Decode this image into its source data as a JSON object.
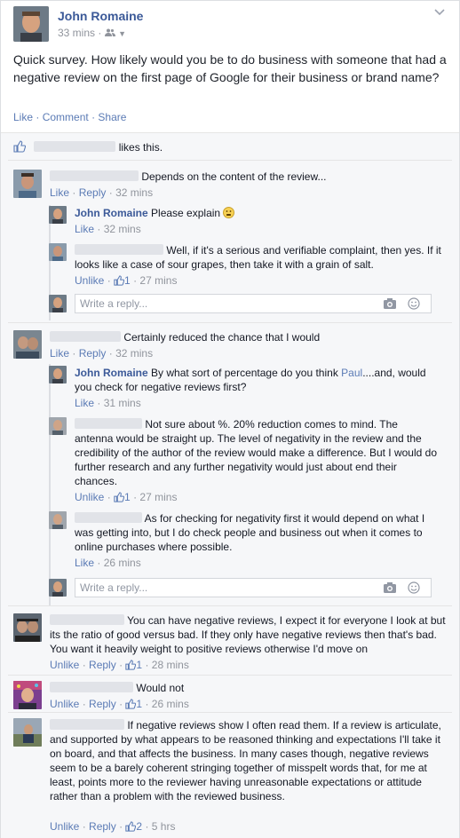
{
  "post": {
    "author": "John Romaine",
    "time": "33 mins",
    "text": "Quick survey. How likely would you be to do business with someone that had a negative review on the first page of Google for their business or brand name?",
    "actions": {
      "like": "Like",
      "comment": "Comment",
      "share": "Share",
      "sep": "·"
    }
  },
  "likes": {
    "suffix": "likes this."
  },
  "labels": {
    "like": "Like",
    "reply": "Reply",
    "unlike": "Unlike",
    "sep": "·"
  },
  "reply_placeholder": "Write a reply...",
  "comments": [
    {
      "text": "Depends on the content of the review...",
      "time": "32 mins"
    },
    {
      "author": "John Romaine",
      "text": "Please explain",
      "time": "32 mins"
    },
    {
      "text": "Well, if it's a serious and verifiable complaint, then yes. If it looks like a case of sour grapes, then take it with a grain of salt.",
      "likes": "1",
      "time": "27 mins"
    },
    {
      "text": "Certainly reduced the chance that I would",
      "time": "32 mins"
    },
    {
      "author": "John Romaine",
      "text_before": "By what sort of percentage do you think ",
      "mention": "Paul",
      "text_after": "....and, would you check for negative reviews first?",
      "time": "31 mins"
    },
    {
      "text": "Not sure about %. 20% reduction comes to mind. The antenna would be straight up. The level of negativity in the review and the credibility of the author of the review would make a difference. But I would do further research and any further negativity would just about end their chances.",
      "likes": "1",
      "time": "27 mins"
    },
    {
      "text": "As for checking for negativity first it would depend on what I was getting into, but I do check people and business out when it comes to online purchases where possible.",
      "time": "26 mins"
    },
    {
      "text": "You can have negative reviews, I expect it for everyone I look at but its the ratio of good versus bad. If they only have negative reviews then that's bad. You want it heavily weight to positive reviews otherwise I'd move on",
      "likes": "1",
      "time": "28 mins"
    },
    {
      "text": "Would not",
      "likes": "1",
      "time": "26 mins"
    },
    {
      "text": "If negative reviews show I often read them. If a review is articulate, and supported by what appears to be reasoned thinking and expectations I'll take it on board, and that affects the business. In many cases though, negative reviews seem to be a barely coherent stringing together of misspelt words that, for me at least, points more to the reviewer having unreasonable expectations or attitude rather than a problem with the reviewed business.",
      "likes": "2",
      "time": "5 hrs"
    }
  ],
  "icons": [
    "thumbs-up-icon",
    "camera-icon",
    "emoji-icon",
    "friends-icon",
    "chevron-down-icon"
  ],
  "colors": {
    "link": "#5b7bb5",
    "name": "#3b5998",
    "muted": "#90949c",
    "ufi_bg": "#f6f7f9"
  }
}
